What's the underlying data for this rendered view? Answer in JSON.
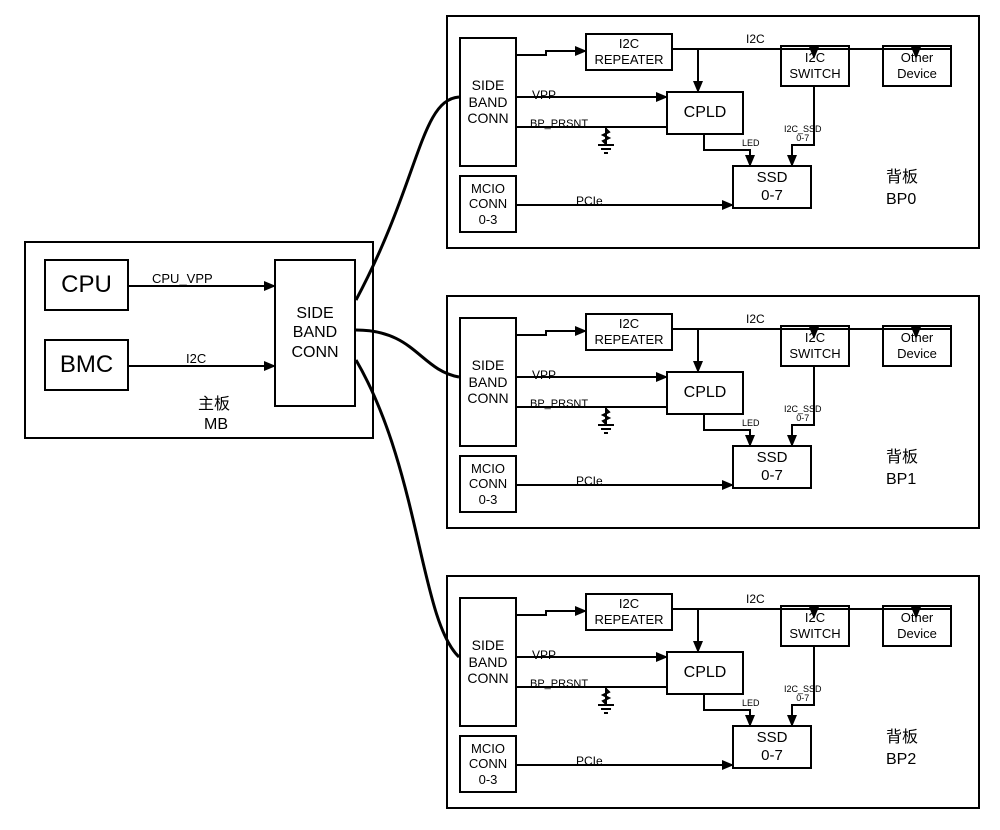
{
  "mb": {
    "label1": "主板",
    "label2": "MB",
    "cpu": "CPU",
    "bmc": "BMC",
    "sideband": "SIDE\nBAND\nCONN",
    "cpu_vpp": "CPU_VPP",
    "i2c": "I2C"
  },
  "bp": [
    {
      "title1": "背板",
      "title2": "BP0",
      "sideband": "SIDE\nBAND\nCONN",
      "i2c_repeater": "I2C\nREPEATER",
      "i2c_switch": "I2C\nSWITCH",
      "other": "Other\nDevice",
      "cpld": "CPLD",
      "ssd": "SSD\n0-7",
      "mcio": "MCIO\nCONN\n0-3",
      "i2c": "I2C",
      "vpp": "VPP",
      "bp_prsnt": "BP_PRSNT",
      "pcie": "PCIe",
      "led": "LED",
      "i2c_ssd": "I2C_SSD\n0-7"
    },
    {
      "title1": "背板",
      "title2": "BP1",
      "sideband": "SIDE\nBAND\nCONN",
      "i2c_repeater": "I2C\nREPEATER",
      "i2c_switch": "I2C\nSWITCH",
      "other": "Other\nDevice",
      "cpld": "CPLD",
      "ssd": "SSD\n0-7",
      "mcio": "MCIO\nCONN\n0-3",
      "i2c": "I2C",
      "vpp": "VPP",
      "bp_prsnt": "BP_PRSNT",
      "pcie": "PCIe",
      "led": "LED",
      "i2c_ssd": "I2C_SSD\n0-7"
    },
    {
      "title1": "背板",
      "title2": "BP2",
      "sideband": "SIDE\nBAND\nCONN",
      "i2c_repeater": "I2C\nREPEATER",
      "i2c_switch": "I2C\nSWITCH",
      "other": "Other\nDevice",
      "cpld": "CPLD",
      "ssd": "SSD\n0-7",
      "mcio": "MCIO\nCONN\n0-3",
      "i2c": "I2C",
      "vpp": "VPP",
      "bp_prsnt": "BP_PRSNT",
      "pcie": "PCIe",
      "led": "LED",
      "i2c_ssd": "I2C_SSD\n0-7"
    }
  ],
  "chart_data": {
    "type": "diagram",
    "title": "Mainboard to 3 Backplanes block diagram",
    "nodes": {
      "MB": [
        "CPU",
        "BMC",
        "SIDE_BAND_CONN"
      ],
      "BP0": [
        "SIDE_BAND_CONN",
        "I2C_REPEATER",
        "I2C_SWITCH",
        "Other_Device",
        "CPLD",
        "SSD_0-7",
        "MCIO_CONN_0-3"
      ],
      "BP1": [
        "SIDE_BAND_CONN",
        "I2C_REPEATER",
        "I2C_SWITCH",
        "Other_Device",
        "CPLD",
        "SSD_0-7",
        "MCIO_CONN_0-3"
      ],
      "BP2": [
        "SIDE_BAND_CONN",
        "I2C_REPEATER",
        "I2C_SWITCH",
        "Other_Device",
        "CPLD",
        "SSD_0-7",
        "MCIO_CONN_0-3"
      ]
    },
    "mb_edges": [
      {
        "from": "CPU",
        "to": "SIDE_BAND_CONN",
        "label": "CPU_VPP"
      },
      {
        "from": "BMC",
        "to": "SIDE_BAND_CONN",
        "label": "I2C"
      },
      {
        "from": "MB.SIDE_BAND_CONN",
        "to": "BP0.SIDE_BAND_CONN",
        "label": ""
      },
      {
        "from": "MB.SIDE_BAND_CONN",
        "to": "BP1.SIDE_BAND_CONN",
        "label": ""
      },
      {
        "from": "MB.SIDE_BAND_CONN",
        "to": "BP2.SIDE_BAND_CONN",
        "label": ""
      }
    ],
    "bp_edges_template": [
      {
        "from": "SIDE_BAND_CONN",
        "to": "I2C_REPEATER",
        "label": ""
      },
      {
        "from": "I2C_REPEATER",
        "to": "CPLD",
        "label": "(I2C bus)"
      },
      {
        "from": "I2C_REPEATER",
        "to": "I2C_SWITCH",
        "label": "I2C"
      },
      {
        "from": "I2C_REPEATER",
        "to": "Other_Device",
        "label": "I2C"
      },
      {
        "from": "SIDE_BAND_CONN",
        "to": "CPLD",
        "label": "VPP"
      },
      {
        "from": "SIDE_BAND_CONN",
        "to": "CPLD",
        "label": "BP_PRSNT (pulled to GND)"
      },
      {
        "from": "MCIO_CONN_0-3",
        "to": "SSD_0-7",
        "label": "PCIe"
      },
      {
        "from": "CPLD",
        "to": "SSD_0-7",
        "label": "LED"
      },
      {
        "from": "I2C_SWITCH",
        "to": "SSD_0-7",
        "label": "I2C_SSD 0-7"
      }
    ]
  }
}
